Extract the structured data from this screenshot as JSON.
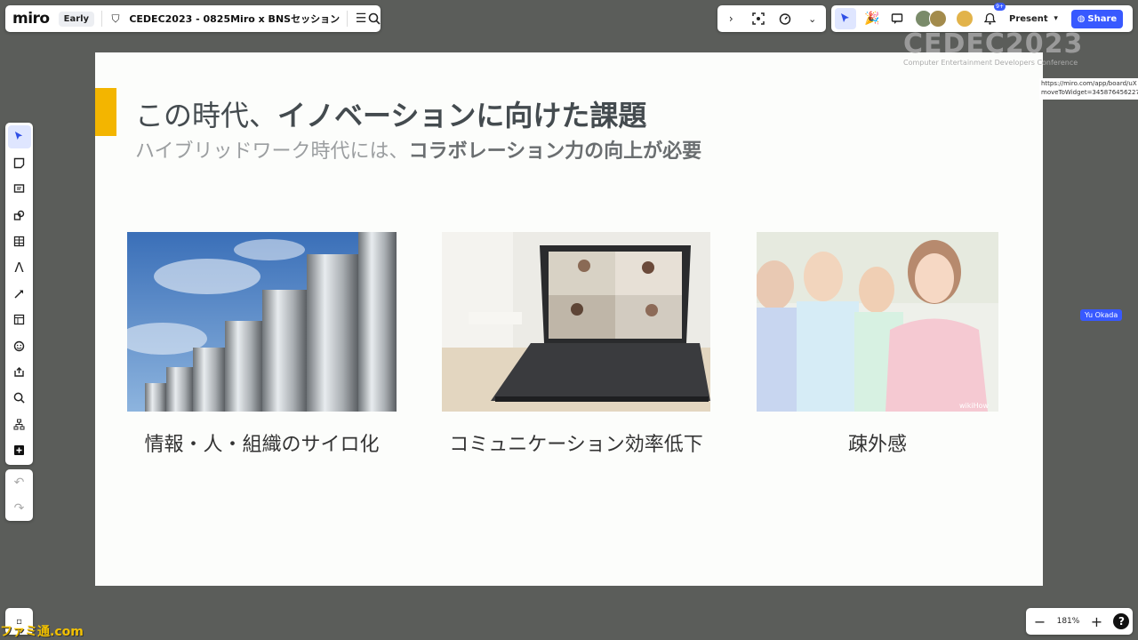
{
  "app": {
    "logo": "miro",
    "badge": "Early",
    "board_title": "CEDEC2023 - 0825Miro x BNSセッション"
  },
  "toolbar_right": {
    "present_label": "Present",
    "share_label": "Share",
    "notification_count": "9+"
  },
  "slide": {
    "title_light": "この時代、",
    "title_bold": "イノベーションに向けた課題",
    "subtitle_light": "ハイブリッドワーク時代には、",
    "subtitle_bold": "コラボレーション力の向上が必要",
    "items": [
      {
        "caption": "情報・人・組織のサイロ化",
        "image": "storage-tanks-photo"
      },
      {
        "caption": "コミュニケーション効率低下",
        "image": "laptop-video-call-photo"
      },
      {
        "caption": "疎外感",
        "image": "isolated-person-illustration"
      }
    ],
    "image_watermark": "wikiHow"
  },
  "overlay": {
    "cedec_logo": "CEDEC2023",
    "cedec_tagline": "Computer Entertainment Developers Conference",
    "tooltip_url_line1": "https://miro.com/app/board/uX",
    "tooltip_url_line2": "moveToWidget=345876456227",
    "cursor_user": "Yu Okada"
  },
  "zoom": {
    "level": "181%"
  },
  "watermark": "ファミ通.com",
  "colors": {
    "accent": "#f3b500",
    "brand_blue": "#3859ff",
    "canvas_bg": "#5b5d5a"
  }
}
